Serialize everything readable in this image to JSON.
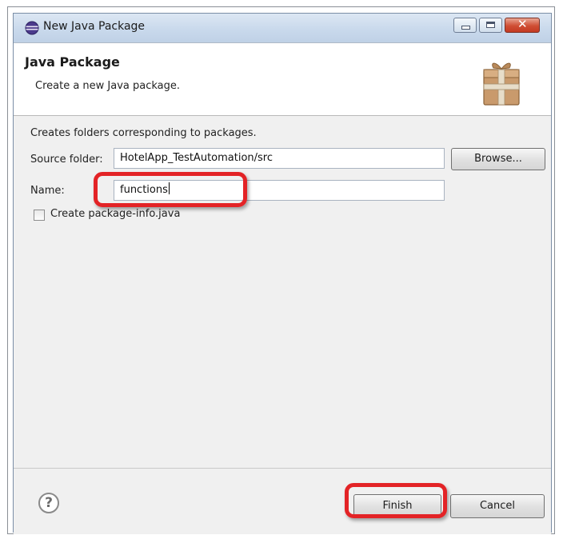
{
  "window": {
    "title": "New Java Package"
  },
  "banner": {
    "title": "Java Package",
    "description": "Create a new Java package.",
    "icon": "package-icon"
  },
  "form": {
    "info": "Creates folders corresponding to packages.",
    "source_label": "Source folder:",
    "source_value": "HotelApp_TestAutomation/src",
    "browse_label": "Browse...",
    "name_label": "Name:",
    "name_value": "functions",
    "checkbox_label": "Create package-info.java",
    "checkbox_checked": false
  },
  "footer": {
    "help_icon": "question-icon",
    "finish_label": "Finish",
    "cancel_label": "Cancel"
  },
  "colors": {
    "highlight": "#e32326",
    "titlebar": "#c9d9ec",
    "dialog_bg": "#f0f0f0"
  }
}
